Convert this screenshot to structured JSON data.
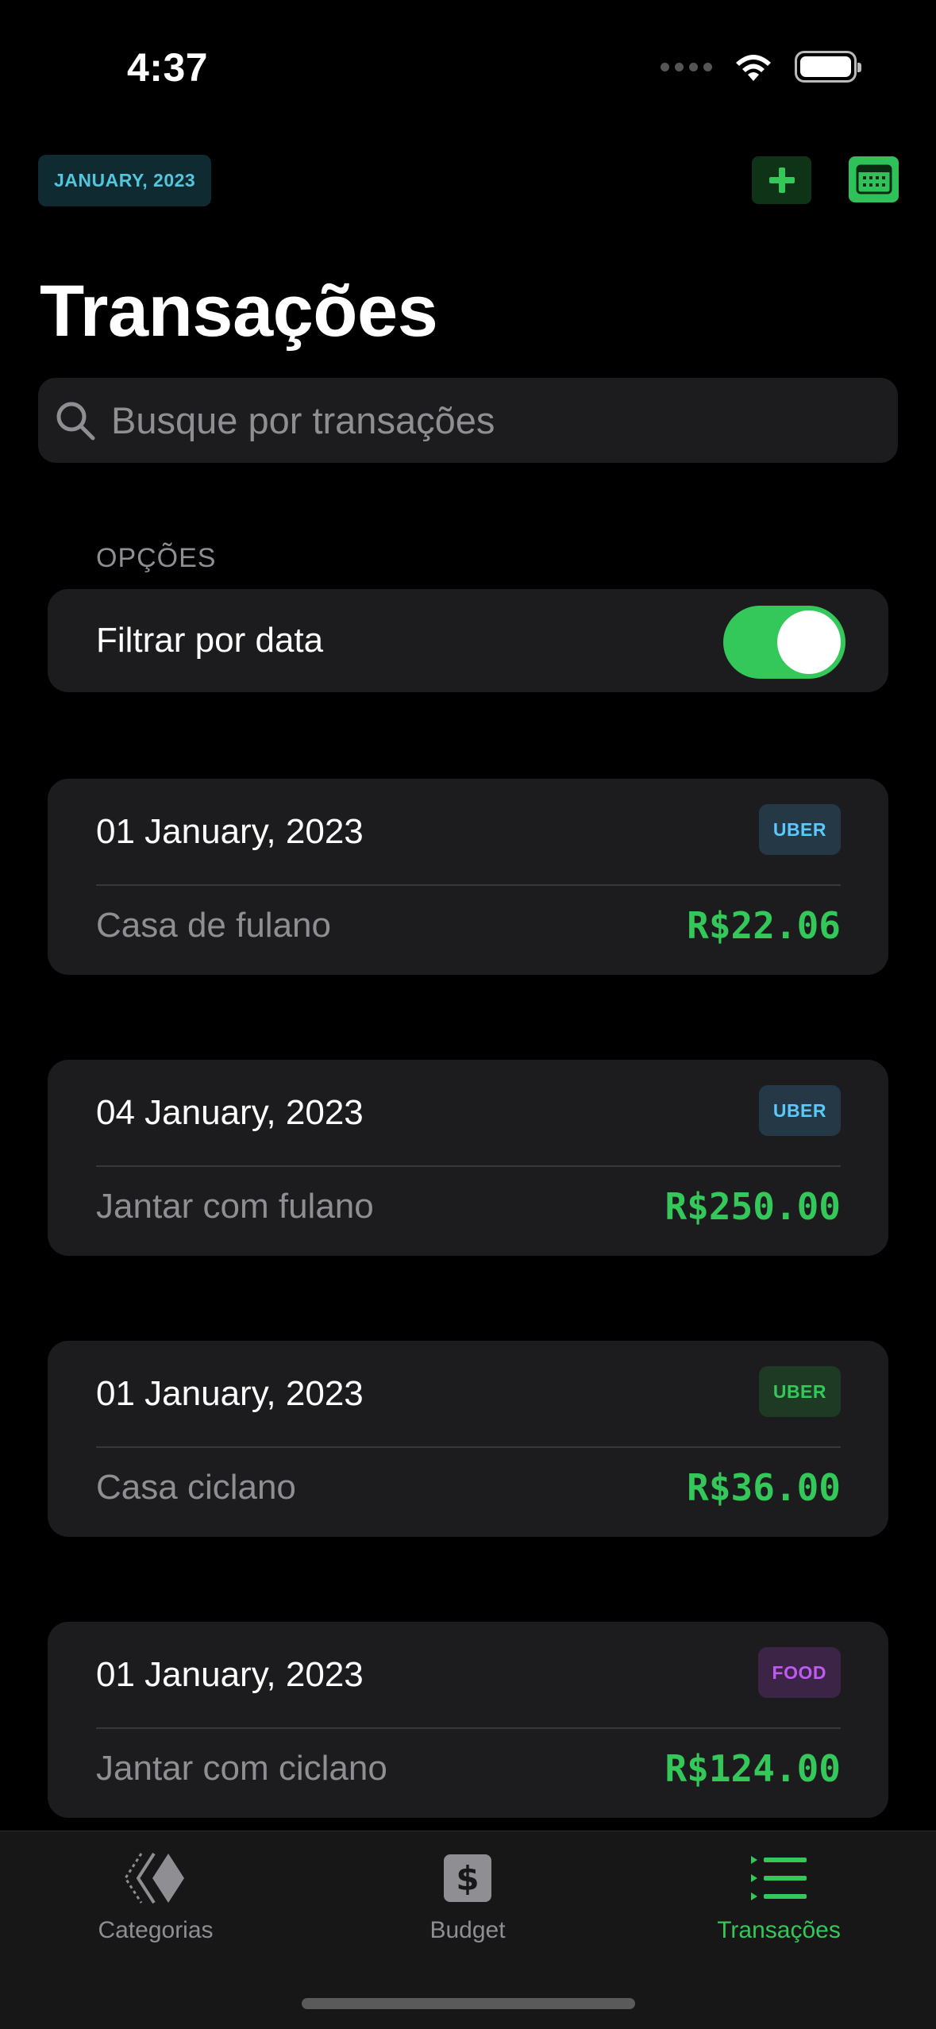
{
  "status_bar": {
    "time": "4:37"
  },
  "header": {
    "month_chip": "JANUARY, 2023",
    "add_icon": "plus-icon",
    "calendar_icon": "calendar-icon",
    "title": "Transações"
  },
  "search": {
    "placeholder": "Busque por transações",
    "icon": "magnifier-icon"
  },
  "options": {
    "section_header": "OPÇÕES",
    "filter_label": "Filtrar por data",
    "filter_enabled": true
  },
  "transactions": [
    {
      "date": "01 January, 2023",
      "category": "UBER",
      "description": "Casa de fulano",
      "amount": "R$22.06",
      "badge_bg": "#243845",
      "badge_fg": "#5ac8fa"
    },
    {
      "date": "04 January, 2023",
      "category": "UBER",
      "description": "Jantar com fulano",
      "amount": "R$250.00",
      "badge_bg": "#243845",
      "badge_fg": "#5ac8fa"
    },
    {
      "date": "01 January, 2023",
      "category": "UBER",
      "description": "Casa ciclano",
      "amount": "R$36.00",
      "badge_bg": "#1e3a25",
      "badge_fg": "#34c759"
    },
    {
      "date": "01 January, 2023",
      "category": "FOOD",
      "description": "Jantar com ciclano",
      "amount": "R$124.00",
      "badge_bg": "#3b2445",
      "badge_fg": "#bf5af2"
    }
  ],
  "tabs": [
    {
      "label": "Categorias",
      "icon": "diamond-stack-icon",
      "active": false
    },
    {
      "label": "Budget",
      "icon": "dollar-icon",
      "active": false
    },
    {
      "label": "Transações",
      "icon": "list-icon",
      "active": true
    }
  ],
  "colors": {
    "accent": "#34c759",
    "background": "#000000",
    "card": "#1c1c1e",
    "muted": "#8e8e93"
  }
}
